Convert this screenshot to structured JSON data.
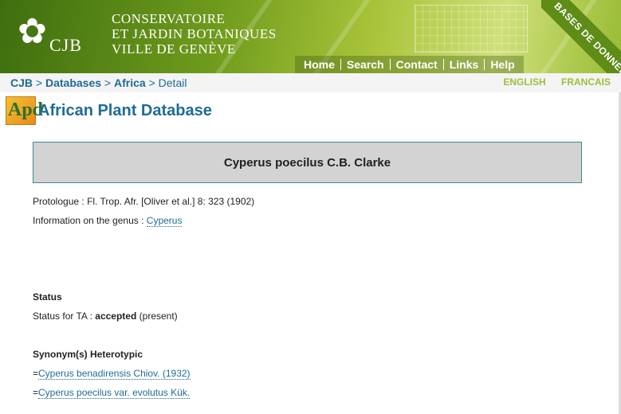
{
  "header": {
    "logo_text": "CJB",
    "institution_lines": [
      "CONSERVATOIRE",
      "ET JARDIN BOTANIQUES",
      "VILLE DE GENÈVE"
    ],
    "nav": [
      "Home",
      "Search",
      "Contact",
      "Links",
      "Help"
    ],
    "corner_label": "BASES DE DONNÉES"
  },
  "breadcrumb": {
    "items": [
      "CJB",
      "Databases",
      "Africa"
    ],
    "current": "Detail",
    "separator": ">"
  },
  "languages": [
    "ENGLISH",
    "FRANCAIS"
  ],
  "page": {
    "logo_letters": "Apd",
    "title": "African Plant Database",
    "species": "Cyperus poecilus C.B. Clarke",
    "protologue_label": "Protologue :",
    "protologue_value": "Fl. Trop. Afr. [Oliver et al.] 8: 323 (1902)",
    "genus_label": "Information on the genus :",
    "genus_link": "Cyperus",
    "status_heading": "Status",
    "status_label": "Status for TA :",
    "status_value": "accepted",
    "status_note": "(present)",
    "synonyms_heading": "Synonym(s) Heterotypic",
    "synonyms": [
      {
        "prefix": "=",
        "name": "Cyperus benadirensis Chiov. (1932)"
      },
      {
        "prefix": "=",
        "name": "Cyperus poecilus var. evolutus Kük."
      }
    ]
  },
  "colors": {
    "link": "#1f6b95",
    "lang": "#9bbf3a",
    "banner": "#6f9b1c",
    "species_box": "#d3d3d3"
  }
}
